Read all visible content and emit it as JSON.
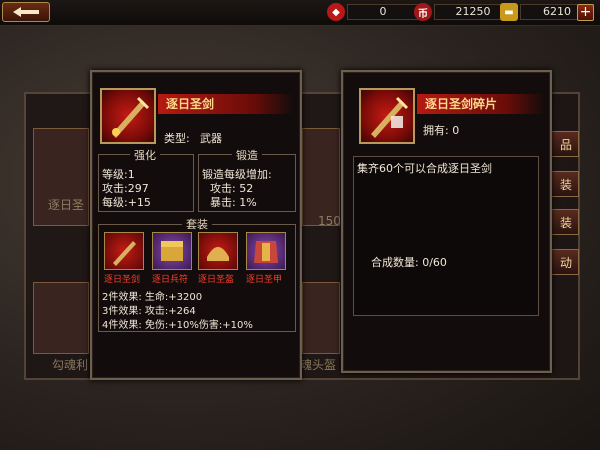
{
  "topbar": {
    "resource_1": {
      "icon": "gem-icon",
      "value": "0"
    },
    "resource_2": {
      "icon": "coin-stack-icon",
      "value": "21250"
    },
    "resource_3": {
      "icon": "gold-ingot-icon",
      "value": "6210"
    },
    "add_label": "+"
  },
  "background": {
    "side_tabs": [
      "品",
      "装",
      "装",
      "动"
    ],
    "left_caption": "勾魂利",
    "right_caption": "魂头盔",
    "tile_caption": "逐日圣",
    "count": "150"
  },
  "item_panel": {
    "name": "逐日圣剑",
    "type_label": "类型:",
    "type_value": "武器",
    "strengthen": {
      "title": "强化",
      "lines": [
        "等级:1",
        "攻击:297",
        "每级:+15"
      ]
    },
    "forge": {
      "title": "锻造",
      "lines": [
        "锻造每级增加:",
        "攻击: 52",
        "暴击: 1%"
      ]
    },
    "set": {
      "title": "套装",
      "items": [
        "逐日圣剑",
        "逐日兵符",
        "逐日圣盔",
        "逐日圣甲"
      ],
      "effects": [
        "2件效果: 生命:+3200",
        "3件效果: 攻击:+264",
        "4件效果: 免伤:+10%伤害:+10%"
      ]
    }
  },
  "fragment_panel": {
    "name": "逐日圣剑碎片",
    "owned": "拥有: 0",
    "description": "集齐60个可以合成逐日圣剑",
    "compose": "合成数量:  0/60"
  },
  "colors": {
    "accent_red": "#b51a12",
    "gold_text": "#ffd88a",
    "set_label_red": "#ff3b2a"
  }
}
